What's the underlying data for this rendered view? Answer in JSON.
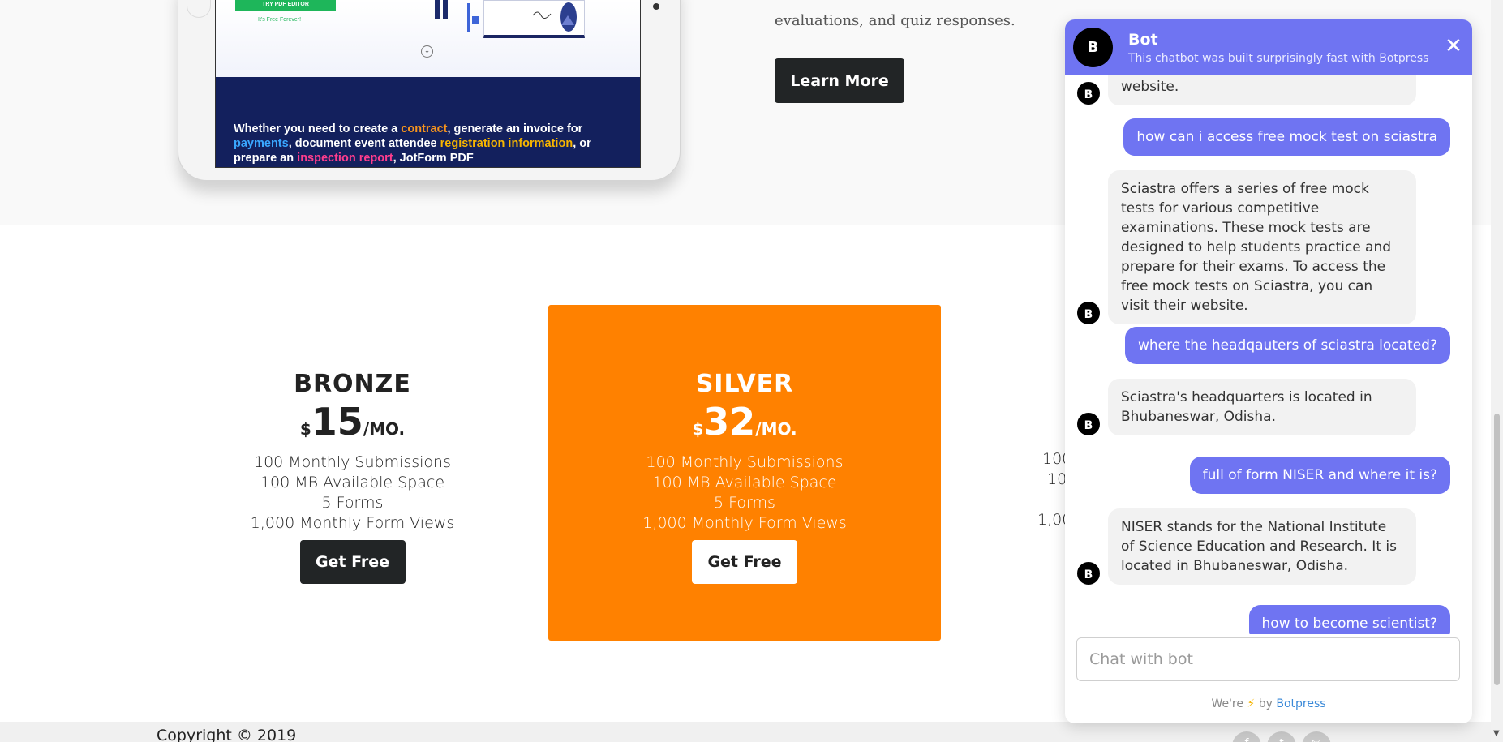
{
  "tablet": {
    "try_button": "TRY PDF EDITOR",
    "free_forever": "It's Free Forever!",
    "promo_text": "Whether you need to create a contract, generate an invoice for payments, document event attendee registration information, or prepare an inspection report, JotForm PDF",
    "promo_highlights": {
      "contract": "#f7941d",
      "payments": "#3aa7ff",
      "registration": "#f7b500",
      "inspection": "#ff3d8d"
    }
  },
  "article": {
    "text": "evaluations, and quiz responses.",
    "learn_more": "Learn More"
  },
  "pricing": {
    "plans": [
      {
        "name": "BRONZE",
        "currency": "$",
        "price": "15",
        "period": "/MO.",
        "features": [
          "100 Monthly Submissions",
          "100 MB Available Space",
          "5 Forms",
          "1,000 Monthly Form Views"
        ],
        "button": "Get Free"
      },
      {
        "name": "SILVER",
        "currency": "$",
        "price": "32",
        "period": "/MO.",
        "features": [
          "100 Monthly Submissions",
          "100 MB Available Space",
          "5 Forms",
          "1,000 Monthly Form Views"
        ],
        "button": "Get Free"
      },
      {
        "partial_features": [
          "100",
          "10",
          "",
          "1,00"
        ]
      }
    ],
    "accent_color": "#ff8100"
  },
  "footer": {
    "copyright": "Copyright © 2019"
  },
  "chat": {
    "avatar_letter": "B",
    "title": "Bot",
    "subtitle": "This chatbot was built surprisingly fast with Botpress",
    "close_icon": "close-icon",
    "messages": [
      {
        "from": "bot",
        "text": "individuals can visit the Sciastra website."
      },
      {
        "from": "user",
        "text": "how can i access free mock test on sciastra"
      },
      {
        "from": "bot",
        "text": "Sciastra offers a series of free mock tests for various competitive examinations. These mock tests are designed to help students practice and prepare for their exams. To access the free mock tests on Sciastra, you can visit their website."
      },
      {
        "from": "user",
        "text": "where the headqauters of sciastra located?"
      },
      {
        "from": "bot",
        "text": "Sciastra's headquarters is located in Bhubaneswar, Odisha."
      },
      {
        "from": "user",
        "text": "full of form NISER and where it is?"
      },
      {
        "from": "bot",
        "text": "NISER stands for the National Institute of Science Education and Research. It is located in Bhubaneswar, Odisha."
      },
      {
        "from": "user",
        "text": "how to become scientist?"
      }
    ],
    "input_placeholder": "Chat with bot",
    "powered_prefix": "We're",
    "powered_by": "by",
    "powered_brand": "Botpress",
    "accent_color": "#6f74f2"
  }
}
